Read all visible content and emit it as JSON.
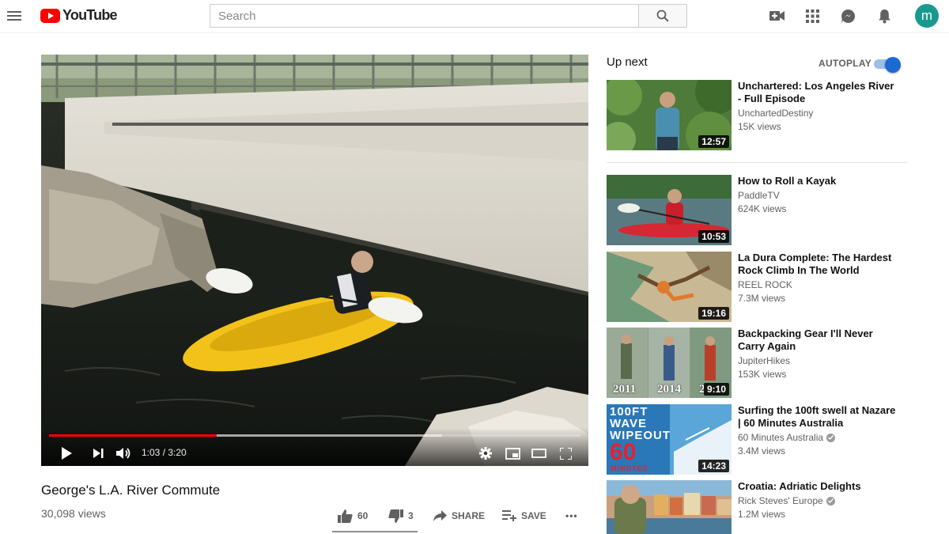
{
  "header": {
    "logo_text": "YouTube",
    "search_placeholder": "Search",
    "avatar_letter": "m",
    "icons": [
      "menu-icon",
      "search-icon",
      "video-camera-icon",
      "apps-grid-icon",
      "messages-icon",
      "bell-icon"
    ]
  },
  "player": {
    "current_time": "1:03",
    "duration": "3:20",
    "time_display": "1:03 / 3:20",
    "progress_fraction": 0.315,
    "buffered_fraction": 0.74
  },
  "video": {
    "title": "George's L.A. River Commute",
    "views": "30,098 views",
    "likes": "60",
    "dislikes": "3",
    "share_label": "SHARE",
    "save_label": "SAVE",
    "more_label": "•••"
  },
  "sidebar": {
    "up_next": "Up next",
    "autoplay": "AUTOPLAY",
    "autoplay_on": true,
    "items": [
      {
        "title": "Unchartered: Los Angeles River - Full Episode",
        "channel": "UnchartedDestiny",
        "views": "15K views",
        "duration": "12:57",
        "verified": false
      },
      {
        "title": "How to Roll a Kayak",
        "channel": "PaddleTV",
        "views": "624K views",
        "duration": "10:53",
        "verified": false
      },
      {
        "title": "La Dura Complete: The Hardest Rock Climb In The World",
        "channel": "REEL ROCK",
        "views": "7.3M views",
        "duration": "19:16",
        "verified": false
      },
      {
        "title": "Backpacking Gear I'll Never Carry Again",
        "channel": "JupiterHikes",
        "views": "153K views",
        "duration": "9:10",
        "verified": false,
        "thumb_years": [
          "2011",
          "2014",
          "2"
        ]
      },
      {
        "title": "Surfing the 100ft swell at Nazare | 60 Minutes Australia",
        "channel": "60 Minutes Australia",
        "views": "3.4M views",
        "duration": "14:23",
        "verified": true,
        "thumb_text": [
          "100FT",
          "WAVE",
          "WIPEOUT",
          "60",
          "MINUTES"
        ]
      },
      {
        "title": "Croatia: Adriatic Delights",
        "channel": "Rick Steves' Europe",
        "views": "1.2M views",
        "duration": "",
        "verified": true
      }
    ]
  },
  "colors": {
    "brand_red": "#ff0000",
    "progress_red": "#ff0000",
    "toggle_blue": "#1b6ad2",
    "avatar_teal": "#199a8e"
  }
}
